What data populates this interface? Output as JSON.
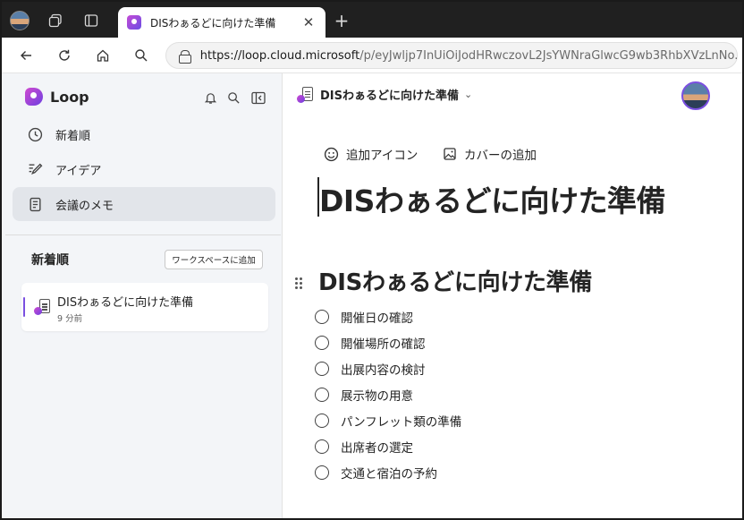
{
  "browser": {
    "tab_title": "DISわぁるどに向けた準備",
    "tab_close": "✕",
    "new_tab": "+",
    "url_host": "https://loop.cloud.microsoft",
    "url_rest": "/p/eyJwljp7InUiOiJodHRwczovL2JsYWNraGlwcG9wb3RhbXVzLnNo..."
  },
  "sidebar": {
    "brand": "Loop",
    "items": [
      {
        "label": "新着順",
        "icon": "clock-icon"
      },
      {
        "label": "アイデア",
        "icon": "idea-pen-icon"
      },
      {
        "label": "会議のメモ",
        "icon": "notes-icon",
        "active": true
      }
    ],
    "recent_heading": "新着順",
    "add_workspace_label": "ワークスペースに追加",
    "recent": [
      {
        "title": "DISわぁるどに向けた準備",
        "time": "9 分前"
      }
    ]
  },
  "page": {
    "breadcrumb_title": "DISわぁるどに向けた準備",
    "add_icon_label": "追加アイコン",
    "add_cover_label": "カバーの追加",
    "title": "DISわぁるどに向けた準備",
    "heading": "DISわぁるどに向けた準備",
    "tasks": [
      "開催日の確認",
      "開催場所の確認",
      "出展内容の検討",
      "展示物の用意",
      "パンフレット類の準備",
      "出席者の選定",
      "交通と宿泊の予約"
    ]
  },
  "colors": {
    "accent": "#7a4fe0",
    "sidebar_bg": "#f3f5f8",
    "tabstrip_bg": "#202020"
  }
}
